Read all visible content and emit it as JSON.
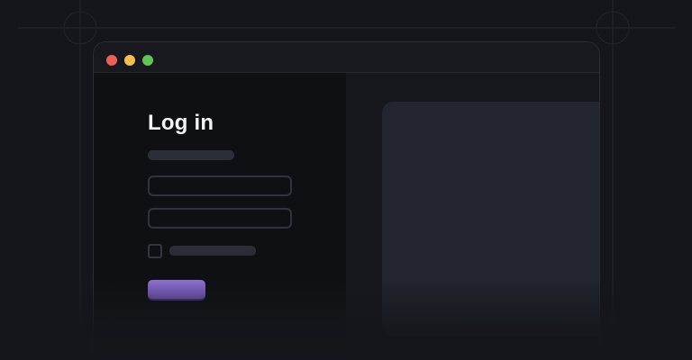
{
  "login": {
    "title": "Log in",
    "email_value": "",
    "password_value": "",
    "submit_label": ""
  },
  "window_controls": [
    "close-dot",
    "minimize-dot",
    "maximize-dot"
  ],
  "colors": {
    "background": "#14161b",
    "window_border": "#2a2d35",
    "left_pane": "#0f1013",
    "right_pane": "#16181d",
    "preview_card": "#23252f",
    "placeholder_bar": "#2b2e36",
    "field_border": "#30333b",
    "accent": "#8b6fd6",
    "dot_red": "#ee5f57",
    "dot_yellow": "#f5bd4f",
    "dot_green": "#5fc454"
  }
}
